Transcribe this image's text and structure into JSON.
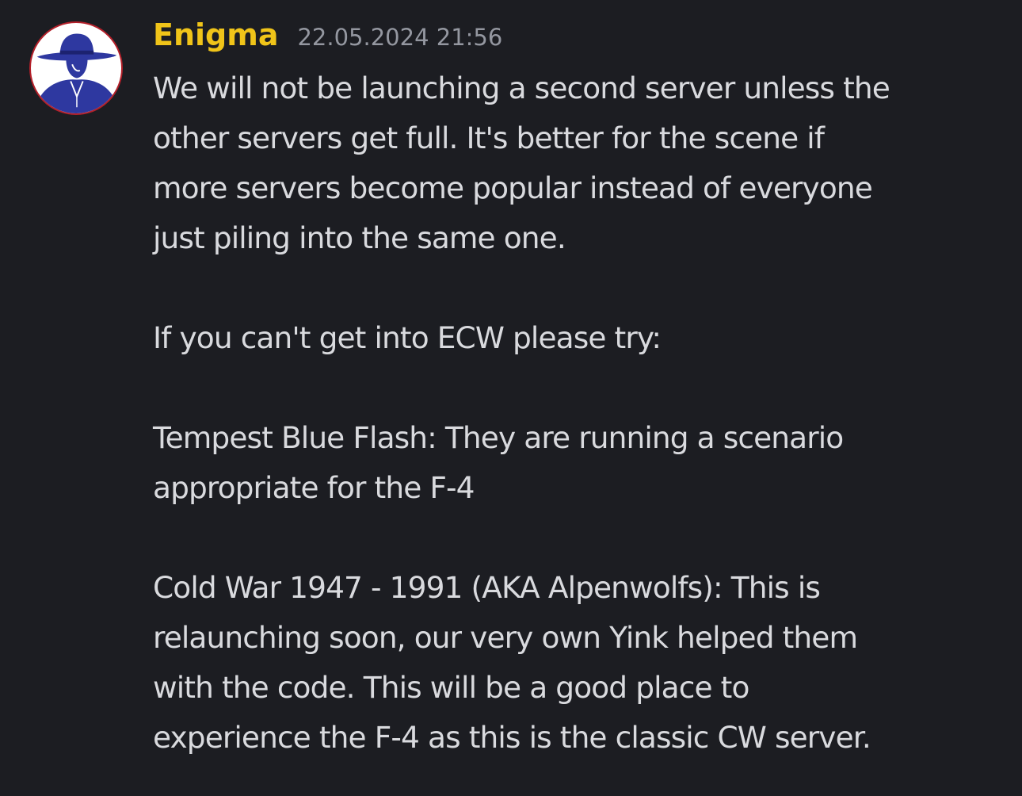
{
  "message": {
    "author": "Enigma",
    "timestamp": "22.05.2024 21:56",
    "avatar_icon": "cowboy-hat-silhouette-icon",
    "colors": {
      "background": "#1c1d22",
      "username": "#f0c419",
      "text": "#d9dade",
      "timestamp": "#9497a0",
      "avatar_figure": "#2e38a0",
      "avatar_ring": "#b3202a"
    },
    "paragraphs": [
      {
        "lines": [
          "We will not be launching a second server unless the",
          "other servers get full. It's better for the scene if",
          "more servers become popular instead of everyone",
          "just piling into the same one."
        ]
      },
      {
        "lines": [
          "If you can't get into ECW please try:"
        ]
      },
      {
        "lines": [
          "Tempest Blue Flash: They are running a scenario",
          "appropriate for the F-4"
        ]
      },
      {
        "lines": [
          "Cold War 1947 - 1991 (AKA Alpenwolfs): This is",
          "relaunching soon, our very own Yink helped them",
          "with the code. This will be a good place to",
          "experience the F-4 as this is the classic CW server."
        ]
      }
    ]
  }
}
